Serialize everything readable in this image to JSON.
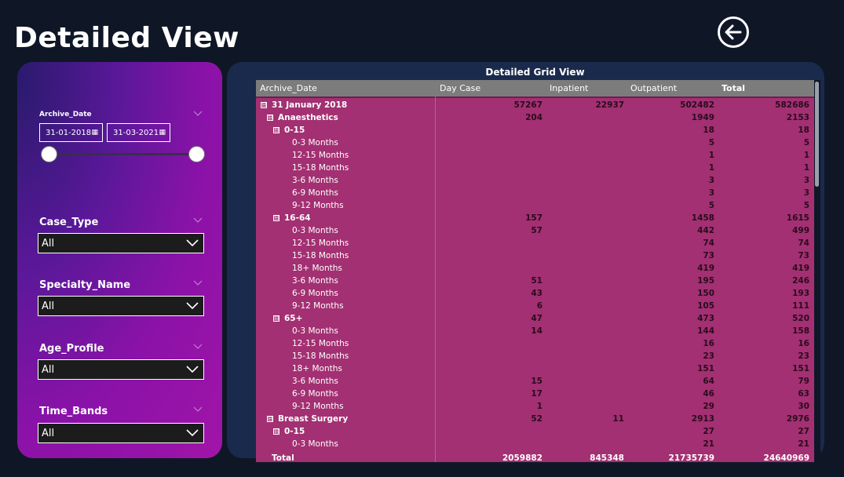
{
  "page": {
    "title": "Detailed View"
  },
  "filters": {
    "archive_date": {
      "label": "Archive_Date",
      "start": "31-01-2018",
      "end": "31-03-2021",
      "slider_start_fraction": 0.0,
      "slider_end_fraction": 1.0
    },
    "dropdowns": [
      {
        "label": "Case_Type",
        "value": "All"
      },
      {
        "label": "Specialty_Name",
        "value": "All"
      },
      {
        "label": "Age_Profile",
        "value": "All"
      },
      {
        "label": "Time_Bands",
        "value": "All"
      }
    ]
  },
  "grid": {
    "title": "Detailed Grid View",
    "columns": [
      "Archive_Date",
      "Day Case",
      "Inpatient",
      "Outpatient",
      "Total"
    ],
    "rows": [
      {
        "level": 0,
        "toggle": "⊟",
        "label": "31 January 2018",
        "bold": true,
        "values": [
          "57267",
          "22937",
          "502482",
          "582686"
        ]
      },
      {
        "level": 1,
        "toggle": "⊟",
        "label": "Anaesthetics",
        "bold": true,
        "values": [
          "204",
          "",
          "1949",
          "2153"
        ]
      },
      {
        "level": 2,
        "toggle": "⊟",
        "label": "0-15",
        "bold": true,
        "values": [
          "",
          "",
          "18",
          "18"
        ]
      },
      {
        "level": 3,
        "toggle": "",
        "label": "0-3 Months",
        "bold": false,
        "values": [
          "",
          "",
          "5",
          "5"
        ]
      },
      {
        "level": 3,
        "toggle": "",
        "label": "12-15 Months",
        "bold": false,
        "values": [
          "",
          "",
          "1",
          "1"
        ]
      },
      {
        "level": 3,
        "toggle": "",
        "label": "15-18 Months",
        "bold": false,
        "values": [
          "",
          "",
          "1",
          "1"
        ]
      },
      {
        "level": 3,
        "toggle": "",
        "label": "3-6 Months",
        "bold": false,
        "values": [
          "",
          "",
          "3",
          "3"
        ]
      },
      {
        "level": 3,
        "toggle": "",
        "label": "6-9 Months",
        "bold": false,
        "values": [
          "",
          "",
          "3",
          "3"
        ]
      },
      {
        "level": 3,
        "toggle": "",
        "label": "9-12 Months",
        "bold": false,
        "values": [
          "",
          "",
          "5",
          "5"
        ]
      },
      {
        "level": 2,
        "toggle": "⊟",
        "label": "16-64",
        "bold": true,
        "values": [
          "157",
          "",
          "1458",
          "1615"
        ]
      },
      {
        "level": 3,
        "toggle": "",
        "label": "0-3 Months",
        "bold": false,
        "values": [
          "57",
          "",
          "442",
          "499"
        ]
      },
      {
        "level": 3,
        "toggle": "",
        "label": "12-15 Months",
        "bold": false,
        "values": [
          "",
          "",
          "74",
          "74"
        ]
      },
      {
        "level": 3,
        "toggle": "",
        "label": "15-18 Months",
        "bold": false,
        "values": [
          "",
          "",
          "73",
          "73"
        ]
      },
      {
        "level": 3,
        "toggle": "",
        "label": "18+ Months",
        "bold": false,
        "values": [
          "",
          "",
          "419",
          "419"
        ]
      },
      {
        "level": 3,
        "toggle": "",
        "label": "3-6 Months",
        "bold": false,
        "values": [
          "51",
          "",
          "195",
          "246"
        ]
      },
      {
        "level": 3,
        "toggle": "",
        "label": "6-9 Months",
        "bold": false,
        "values": [
          "43",
          "",
          "150",
          "193"
        ]
      },
      {
        "level": 3,
        "toggle": "",
        "label": "9-12 Months",
        "bold": false,
        "values": [
          "6",
          "",
          "105",
          "111"
        ]
      },
      {
        "level": 2,
        "toggle": "⊟",
        "label": "65+",
        "bold": true,
        "values": [
          "47",
          "",
          "473",
          "520"
        ]
      },
      {
        "level": 3,
        "toggle": "",
        "label": "0-3 Months",
        "bold": false,
        "values": [
          "14",
          "",
          "144",
          "158"
        ]
      },
      {
        "level": 3,
        "toggle": "",
        "label": "12-15 Months",
        "bold": false,
        "values": [
          "",
          "",
          "16",
          "16"
        ]
      },
      {
        "level": 3,
        "toggle": "",
        "label": "15-18 Months",
        "bold": false,
        "values": [
          "",
          "",
          "23",
          "23"
        ]
      },
      {
        "level": 3,
        "toggle": "",
        "label": "18+ Months",
        "bold": false,
        "values": [
          "",
          "",
          "151",
          "151"
        ]
      },
      {
        "level": 3,
        "toggle": "",
        "label": "3-6 Months",
        "bold": false,
        "values": [
          "15",
          "",
          "64",
          "79"
        ]
      },
      {
        "level": 3,
        "toggle": "",
        "label": "6-9 Months",
        "bold": false,
        "values": [
          "17",
          "",
          "46",
          "63"
        ]
      },
      {
        "level": 3,
        "toggle": "",
        "label": "9-12 Months",
        "bold": false,
        "values": [
          "1",
          "",
          "29",
          "30"
        ]
      },
      {
        "level": 1,
        "toggle": "⊟",
        "label": "Breast Surgery",
        "bold": true,
        "values": [
          "52",
          "11",
          "2913",
          "2976"
        ]
      },
      {
        "level": 2,
        "toggle": "⊟",
        "label": "0-15",
        "bold": true,
        "values": [
          "",
          "",
          "27",
          "27"
        ]
      },
      {
        "level": 3,
        "toggle": "",
        "label": "0-3 Months",
        "bold": false,
        "values": [
          "",
          "",
          "21",
          "21"
        ]
      }
    ],
    "total": {
      "label": "Total",
      "values": [
        "2059882",
        "845348",
        "21735739",
        "24640969"
      ]
    }
  },
  "colors": {
    "background": "#0f1727",
    "grid_background": "#a33072",
    "header_background": "#7c7c7c",
    "panel_background": "#1a2a4c"
  },
  "icons": {
    "back": "back-arrow-circle-icon",
    "calendar": "calendar-icon",
    "dropdown": "chevron-down-icon"
  }
}
